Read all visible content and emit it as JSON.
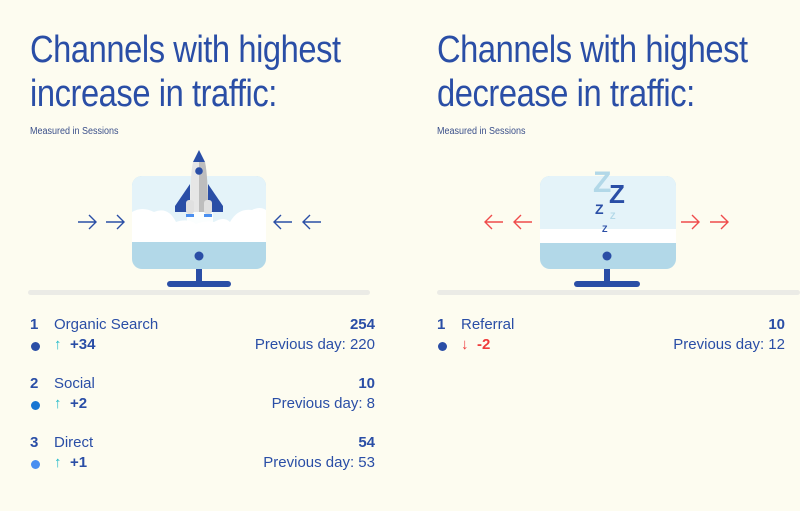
{
  "colors": {
    "background": "#fdfcf0",
    "primary_text": "#2a4ea6",
    "increase": "#1fb9c9",
    "decrease": "#ef3b3b",
    "monitor_screen": "#e4f3f9",
    "monitor_base": "#b2d8e8",
    "monitor_stand": "#2a4ea6"
  },
  "increase_panel": {
    "title_line1": "Channels with highest",
    "title_line2": "increase in traffic:",
    "subtitle": "Measured in Sessions",
    "illustration": "rocket-launch-monitor",
    "items": [
      {
        "rank": "1",
        "name": "Organic Search",
        "value": "254",
        "arrow": "↑",
        "delta": "+34",
        "previous": "Previous day: 220",
        "dot_color": "#2a4ea6"
      },
      {
        "rank": "2",
        "name": "Social",
        "value": "10",
        "arrow": "↑",
        "delta": "+2",
        "previous": "Previous day: 8",
        "dot_color": "#1976d2"
      },
      {
        "rank": "3",
        "name": "Direct",
        "value": "54",
        "arrow": "↑",
        "delta": "+1",
        "previous": "Previous day: 53",
        "dot_color": "#4a8ff0"
      }
    ]
  },
  "decrease_panel": {
    "title_line1": "Channels with highest",
    "title_line2": "decrease in traffic:",
    "subtitle": "Measured in Sessions",
    "illustration": "sleeping-monitor",
    "items": [
      {
        "rank": "1",
        "name": "Referral",
        "value": "10",
        "arrow": "↓",
        "delta": "-2",
        "previous": "Previous day: 12",
        "dot_color": "#2a4ea6"
      }
    ]
  }
}
